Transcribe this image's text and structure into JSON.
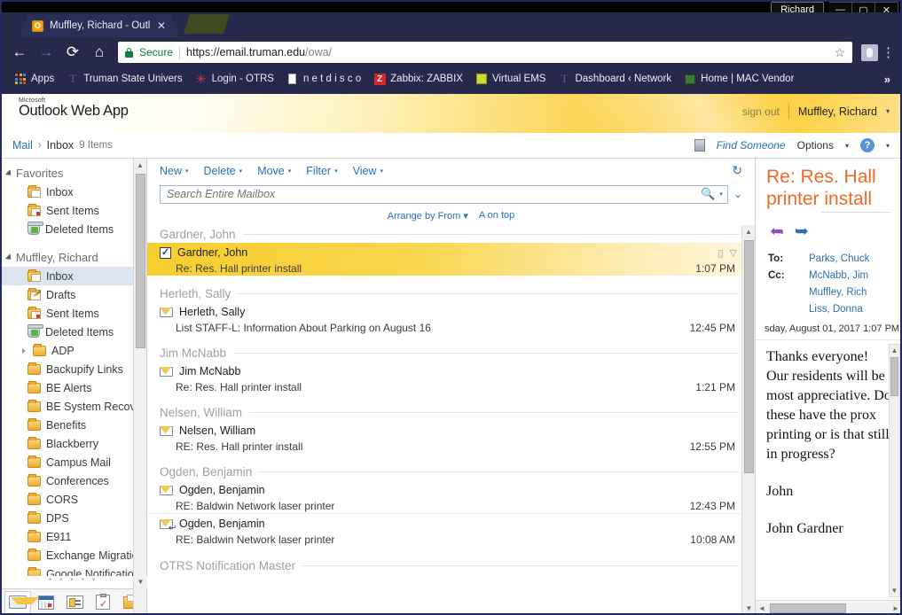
{
  "os": {
    "profile_label": "Richard",
    "minimize": "—",
    "maximize": "▢",
    "close": "✕"
  },
  "browser": {
    "tab": {
      "title": "Muffley, Richard - Outloo",
      "favicon": "outlook-icon",
      "close": "✕"
    },
    "nav": {
      "back": "←",
      "forward": "→",
      "reload": "⟳",
      "home": "⌂"
    },
    "omnibox": {
      "security_label": "Secure",
      "url_main": "https://email.truman.edu",
      "url_tail": "/owa/",
      "star": "☆",
      "menu": "⋮"
    },
    "bookmarks": [
      {
        "label": "Apps",
        "icon": "apps-grid-icon"
      },
      {
        "label": "Truman State Univers",
        "icon": "truman-t-icon"
      },
      {
        "label": "Login - OTRS",
        "icon": "otrs-starburst-icon"
      },
      {
        "label": "n e t d i s c o",
        "icon": "page-icon"
      },
      {
        "label": "Zabbix: ZABBIX",
        "icon": "zabbix-z-icon"
      },
      {
        "label": "Virtual EMS",
        "icon": "ems-icon"
      },
      {
        "label": "Dashboard ‹ Network",
        "icon": "truman-t-icon"
      },
      {
        "label": "Home | MAC Vendor",
        "icon": "monitor-icon"
      }
    ],
    "bookmarks_overflow": "»"
  },
  "owa": {
    "brand_small": "Microsoft",
    "brand_main": "Outlook Web App",
    "sign_out": "sign out",
    "user": "Muffley, Richard",
    "user_caret": "▾",
    "breadcrumb": {
      "mail": "Mail",
      "sep": "›",
      "folder": "Inbox",
      "count": "9 Items"
    },
    "find_someone": "Find Someone",
    "options": "Options",
    "options_caret": "▾",
    "help": "?",
    "help_caret": "▾"
  },
  "nav": {
    "groups": [
      {
        "label": "Favorites",
        "items": [
          {
            "label": "Inbox",
            "icon": "mail-folder-icon",
            "selected": false
          },
          {
            "label": "Sent Items",
            "icon": "sent-folder-icon",
            "selected": false
          },
          {
            "label": "Deleted Items",
            "icon": "trash-icon",
            "selected": false
          }
        ]
      },
      {
        "label": "Muffley, Richard",
        "items": [
          {
            "label": "Inbox",
            "icon": "mail-folder-icon",
            "selected": true
          },
          {
            "label": "Drafts",
            "icon": "drafts-folder-icon",
            "selected": false
          },
          {
            "label": "Sent Items",
            "icon": "sent-folder-icon",
            "selected": false
          },
          {
            "label": "Deleted Items",
            "icon": "trash-icon",
            "selected": false
          },
          {
            "label": "ADP",
            "icon": "folder-icon",
            "expandable": true,
            "selected": false
          },
          {
            "label": "Backupify Links",
            "icon": "folder-icon",
            "selected": false
          },
          {
            "label": "BE Alerts",
            "icon": "folder-icon",
            "selected": false
          },
          {
            "label": "BE System Recovery",
            "icon": "folder-icon",
            "selected": false
          },
          {
            "label": "Benefits",
            "icon": "folder-icon",
            "selected": false
          },
          {
            "label": "Blackberry",
            "icon": "folder-icon",
            "selected": false
          },
          {
            "label": "Campus Mail",
            "icon": "folder-icon",
            "selected": false
          },
          {
            "label": "Conferences",
            "icon": "folder-icon",
            "selected": false
          },
          {
            "label": "CORS",
            "icon": "folder-icon",
            "selected": false
          },
          {
            "label": "DPS",
            "icon": "folder-icon",
            "selected": false
          },
          {
            "label": "E911",
            "icon": "folder-icon",
            "selected": false
          },
          {
            "label": "Exchange Migration",
            "icon": "folder-icon",
            "selected": false
          },
          {
            "label": "Google Notifications",
            "icon": "folder-icon",
            "selected": false
          }
        ]
      }
    ],
    "resize_dots": "• • • • •",
    "modules": [
      {
        "name": "mail-module",
        "active": true
      },
      {
        "name": "calendar-module",
        "active": false
      },
      {
        "name": "contacts-module",
        "active": false
      },
      {
        "name": "tasks-module",
        "active": false
      },
      {
        "name": "folders-module",
        "active": false
      }
    ]
  },
  "list": {
    "toolbar": [
      {
        "label": "New",
        "caret": "▾"
      },
      {
        "label": "Delete",
        "caret": "▾"
      },
      {
        "label": "Move",
        "caret": "▾"
      },
      {
        "label": "Filter",
        "caret": "▾"
      },
      {
        "label": "View",
        "caret": "▾"
      }
    ],
    "refresh_icon": "↻",
    "search_placeholder": "Search Entire Mailbox",
    "search_value": "",
    "search_icon": "search-icon",
    "expand_icon": "⌄",
    "arrange_by": "Arrange by From",
    "arrange_caret": "▾",
    "sort_order": "A on top",
    "groups": [
      {
        "header": "Gardner, John",
        "messages": [
          {
            "from": "Gardner, John",
            "subject": "Re: Res. Hall printer install",
            "time": "1:07 PM",
            "selected": true,
            "checked": true,
            "icon": "checkbox-checked",
            "flags": [
              "attachment-icon",
              "flag-icon"
            ]
          }
        ]
      },
      {
        "header": "Herleth, Sally",
        "messages": [
          {
            "from": "Herleth, Sally",
            "subject": "List STAFF-L: Information About Parking on August 16",
            "time": "12:45 PM",
            "selected": false,
            "checked": false,
            "icon": "envelope-icon",
            "flags": []
          }
        ]
      },
      {
        "header": "Jim McNabb",
        "messages": [
          {
            "from": "Jim McNabb",
            "subject": "Re: Res. Hall printer install",
            "time": "1:21 PM",
            "selected": false,
            "checked": false,
            "icon": "envelope-icon",
            "flags": []
          }
        ]
      },
      {
        "header": "Nelsen, William",
        "messages": [
          {
            "from": "Nelsen, William",
            "subject": "RE: Res. Hall printer install",
            "time": "12:55 PM",
            "selected": false,
            "checked": false,
            "icon": "envelope-icon",
            "flags": []
          }
        ]
      },
      {
        "header": "Ogden, Benjamin",
        "messages": [
          {
            "from": "Ogden, Benjamin",
            "subject": "RE: Baldwin Network laser printer",
            "time": "12:43 PM",
            "selected": false,
            "checked": false,
            "icon": "envelope-icon",
            "flags": []
          },
          {
            "from": "Ogden, Benjamin",
            "subject": "RE: Baldwin Network laser printer",
            "time": "10:08 AM",
            "selected": false,
            "checked": false,
            "icon": "envelope-replied-icon",
            "flags": []
          }
        ]
      },
      {
        "header": "OTRS Notification Master",
        "messages": []
      }
    ]
  },
  "reading": {
    "subject": "Re: Res. Hall printer install",
    "reply_icon": "reply-icon",
    "forward_icon": "forward-icon",
    "to_label": "To:",
    "to_values": [
      "Parks, Chuck"
    ],
    "cc_label": "Cc:",
    "cc_values": [
      "McNabb, Jim",
      "Muffley, Rich",
      "Liss, Donna"
    ],
    "date": "sday, August 01, 2017 1:07 PM",
    "body_paragraphs": [
      "Thanks everyone!  Our residents will be most appreciative.  Do these have the prox printing or is that still in progress?",
      "John",
      "John Gardner"
    ],
    "scroll_up": "▲",
    "scroll_down": "▼",
    "scroll_left": "◄",
    "scroll_right": "►"
  },
  "colors": {
    "chrome_frame": "#262949",
    "owa_accent": "#fcc930",
    "link_blue": "#2a6fb5",
    "subject_orange": "#ef6a25",
    "selection_yellow": "#f7cd2f"
  }
}
